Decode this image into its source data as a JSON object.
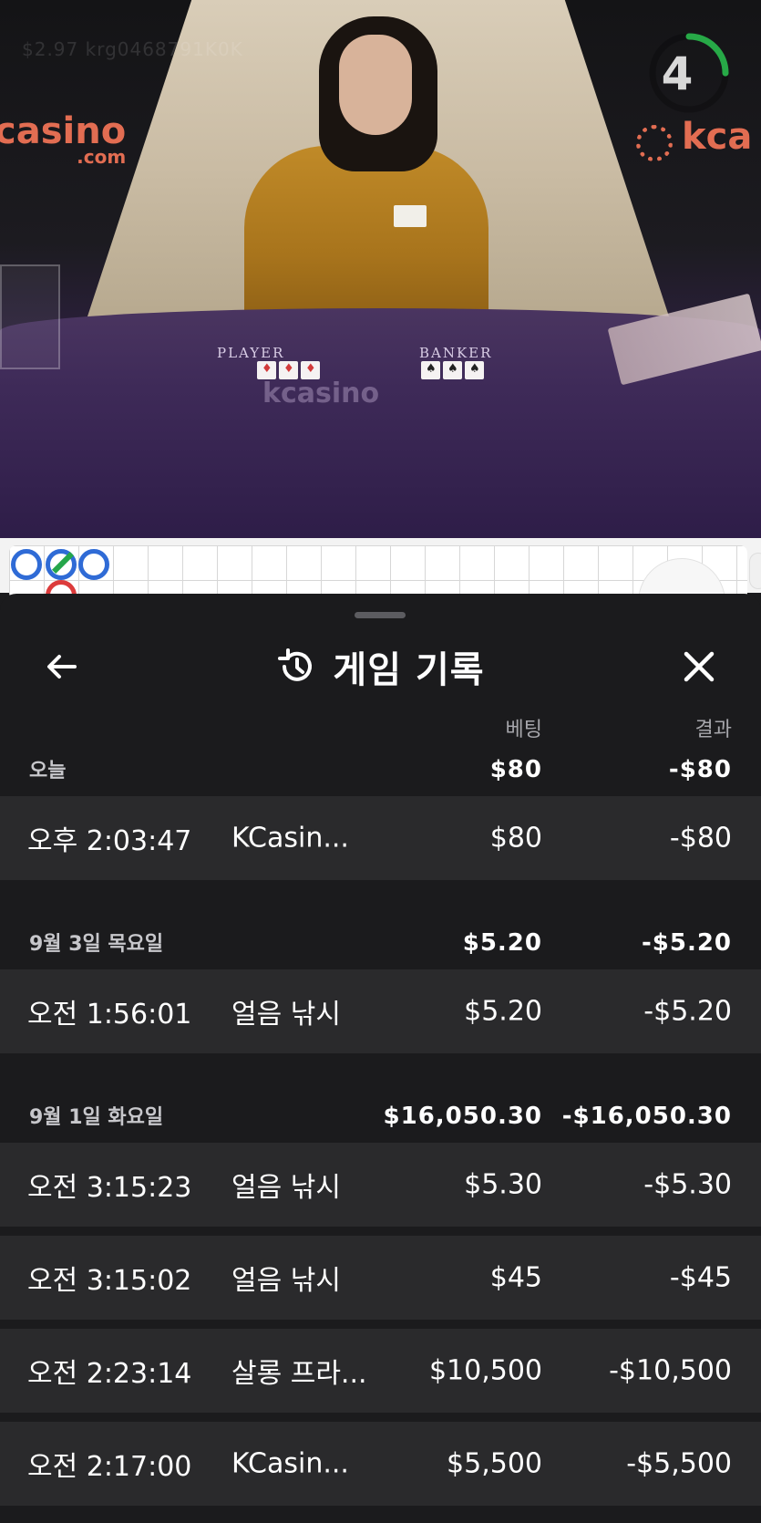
{
  "video": {
    "watermark": "$2.97 krg0468791K0K",
    "logo_left": "casino",
    "logo_left_sub": ".com",
    "logo_right": "kca",
    "felt_logo": "kcasino",
    "table_labels": {
      "player": "PLAYER",
      "banker": "BANKER"
    },
    "countdown": "4",
    "countdown_progress": 0.25
  },
  "sheet": {
    "back_icon": "arrow-left-icon",
    "history_icon": "history-icon",
    "close_icon": "close-icon",
    "title": "게임 기록",
    "col_bet": "베팅",
    "col_result": "결과"
  },
  "groups": [
    {
      "date": "오늘",
      "bet_total": "$80",
      "result_total": "-$80",
      "rows": [
        {
          "time": "오후 2:03:47",
          "game": "KCasin...",
          "bet": "$80",
          "result": "-$80"
        }
      ]
    },
    {
      "date": "9월 3일 목요일",
      "bet_total": "$5.20",
      "result_total": "-$5.20",
      "rows": [
        {
          "time": "오전 1:56:01",
          "game": "얼음 낚시",
          "bet": "$5.20",
          "result": "-$5.20"
        }
      ]
    },
    {
      "date": "9월 1일 화요일",
      "bet_total": "$16,050.30",
      "result_total": "-$16,050.30",
      "rows": [
        {
          "time": "오전 3:15:23",
          "game": "얼음 낚시",
          "bet": "$5.30",
          "result": "-$5.30"
        },
        {
          "time": "오전 3:15:02",
          "game": "얼음 낚시",
          "bet": "$45",
          "result": "-$45"
        },
        {
          "time": "오전 2:23:14",
          "game": "살롱 프라...",
          "bet": "$10,500",
          "result": "-$10,500"
        },
        {
          "time": "오전 2:17:00",
          "game": "KCasin...",
          "bet": "$5,500",
          "result": "-$5,500"
        }
      ]
    }
  ]
}
